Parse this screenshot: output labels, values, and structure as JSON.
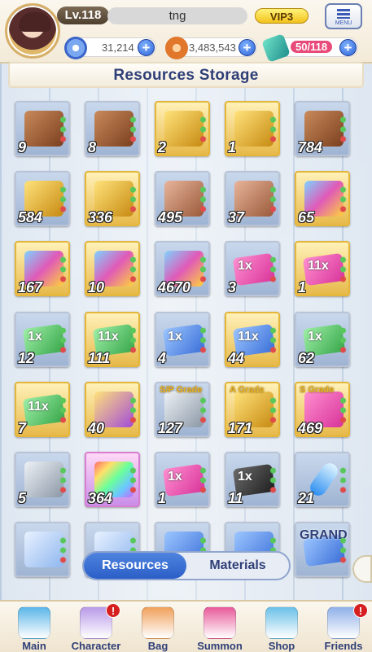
{
  "header": {
    "level": "Lv.118",
    "player_name": "tng",
    "vip": "VIP3",
    "menu_label": "MENU",
    "stats": [
      {
        "icon": "star-gem-icon",
        "value": "31,214"
      },
      {
        "icon": "coin-icon",
        "value": "3,483,543"
      },
      {
        "icon": "stamina-icon",
        "value": "50/118"
      }
    ]
  },
  "page_title": "Resources Storage",
  "items": [
    {
      "icon": "bronze-chest-i-icon",
      "qty": "9"
    },
    {
      "icon": "bronze-chest-ii-icon",
      "qty": "8"
    },
    {
      "icon": "gold-chest-i-icon",
      "qty": "2"
    },
    {
      "icon": "gold-chest-ii-icon",
      "qty": "1"
    },
    {
      "icon": "bronze-chest-iii-icon",
      "qty": "784"
    },
    {
      "icon": "gold-chest-iii-icon",
      "qty": "584"
    },
    {
      "icon": "gold-chest-iv-icon",
      "qty": "336"
    },
    {
      "icon": "copper-chest-icon",
      "qty": "495"
    },
    {
      "icon": "copper-chest-ii-icon",
      "qty": "37"
    },
    {
      "icon": "gem-box-v-icon",
      "qty": "65"
    },
    {
      "icon": "gem-box-iii-icon",
      "qty": "167"
    },
    {
      "icon": "gem-box-iv-icon",
      "qty": "10"
    },
    {
      "icon": "gem-box-v-blue-icon",
      "qty": "4670"
    },
    {
      "icon": "pink-ticket-1x-icon",
      "qty": "3",
      "label": "1x"
    },
    {
      "icon": "pink-ticket-11x-icon",
      "qty": "1",
      "label": "11x"
    },
    {
      "icon": "green-ticket-1x-icon",
      "qty": "12",
      "label": "1x"
    },
    {
      "icon": "green-ticket-11x-icon",
      "qty": "111",
      "label": "11x"
    },
    {
      "icon": "blue-ticket-1x-icon",
      "qty": "4",
      "label": "1x"
    },
    {
      "icon": "blue-ticket-11x-icon",
      "qty": "44",
      "label": "11x"
    },
    {
      "icon": "green-ticket-1x-alt-icon",
      "qty": "62",
      "label": "1x"
    },
    {
      "icon": "green-ticket-11x-alt-icon",
      "qty": "7",
      "label": "11x"
    },
    {
      "icon": "treasure-chest-vi-icon",
      "qty": "40"
    },
    {
      "icon": "sp-grade-chest-icon",
      "qty": "127",
      "grade": "S/P Grade"
    },
    {
      "icon": "a-grade-chest-icon",
      "qty": "171",
      "grade": "A Grade"
    },
    {
      "icon": "s-grade-chest-icon",
      "qty": "469",
      "grade": "S Grade"
    },
    {
      "icon": "silver-box-icon",
      "qty": "5"
    },
    {
      "icon": "rainbow-gem-box-icon",
      "qty": "364"
    },
    {
      "icon": "bird-arcade-ticket-icon",
      "qty": "1",
      "label": "1x"
    },
    {
      "icon": "black-friday-ticket-icon",
      "qty": "11",
      "label": "1x"
    },
    {
      "icon": "potion-vial-icon",
      "qty": "21"
    },
    {
      "icon": "capsule-icon",
      "qty": ""
    },
    {
      "icon": "capsule-ii-icon",
      "qty": ""
    },
    {
      "icon": "partial-item-icon",
      "qty": ""
    },
    {
      "icon": "partial-item-ii-icon",
      "qty": ""
    },
    {
      "icon": "grand-ticket-icon",
      "qty": "",
      "label": "GRAND"
    }
  ],
  "tabs": {
    "resources": "Resources",
    "materials": "Materials"
  },
  "nav": [
    {
      "label": "Main",
      "icon": "city-icon"
    },
    {
      "label": "Character",
      "icon": "character-icon",
      "alert": "!"
    },
    {
      "label": "Bag",
      "icon": "bag-icon"
    },
    {
      "label": "Summon",
      "icon": "phone-summon-icon"
    },
    {
      "label": "Shop",
      "icon": "cart-icon"
    },
    {
      "label": "Friends",
      "icon": "friends-icon",
      "alert": "!"
    }
  ]
}
